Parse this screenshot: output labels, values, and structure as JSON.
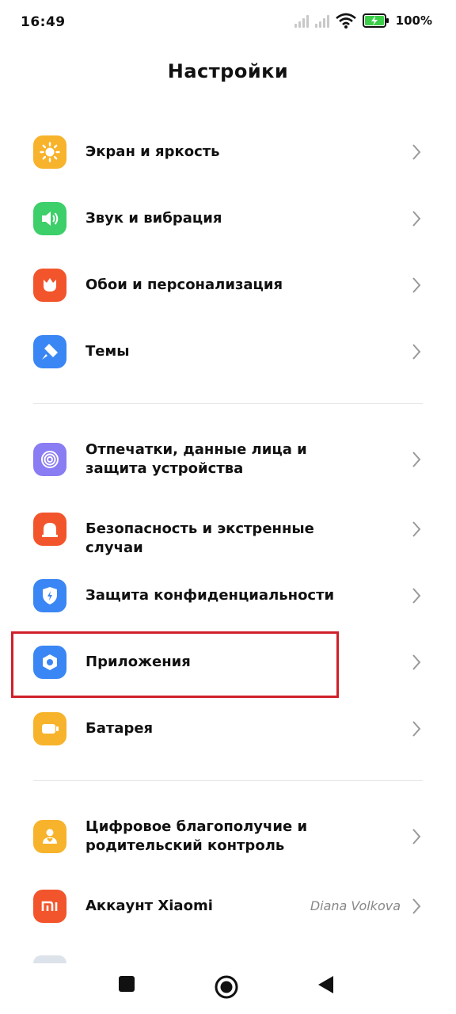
{
  "status": {
    "time": "16:49",
    "battery_pct": "100%"
  },
  "header": {
    "title": "Настройки"
  },
  "sections": [
    {
      "items": [
        {
          "label": "Экран и яркость",
          "icon": "sun-icon",
          "color": "#f7b32b"
        },
        {
          "label": "Звук и вибрация",
          "icon": "speaker-icon",
          "color": "#3ccf6a"
        },
        {
          "label": "Обои и персонализация",
          "icon": "tulip-icon",
          "color": "#f2552c"
        },
        {
          "label": "Темы",
          "icon": "brush-icon",
          "color": "#3a86f4"
        }
      ]
    },
    {
      "items": [
        {
          "label": "Отпечатки, данные лица и защита устройства",
          "icon": "fingerprint-icon",
          "color": "#8a7cf2"
        },
        {
          "label": "Безопасность и экстренные случаи",
          "icon": "alarm-icon",
          "color": "#f2552c"
        },
        {
          "label": "Защита конфиденциальности",
          "icon": "shield-icon",
          "color": "#3a86f4"
        },
        {
          "label": "Приложения",
          "icon": "hexagon-gear-icon",
          "color": "#3a86f4"
        },
        {
          "label": "Батарея",
          "icon": "battery-icon",
          "color": "#f7b32b"
        }
      ]
    },
    {
      "items": [
        {
          "label": "Цифровое благополучие и родительский контроль",
          "icon": "person-heart-icon",
          "color": "#f7b32b"
        },
        {
          "label": "Аккаунт Xiaomi",
          "icon": "mi-logo-icon",
          "color": "#f2552c",
          "value": "Diana Volkova"
        }
      ]
    }
  ]
}
